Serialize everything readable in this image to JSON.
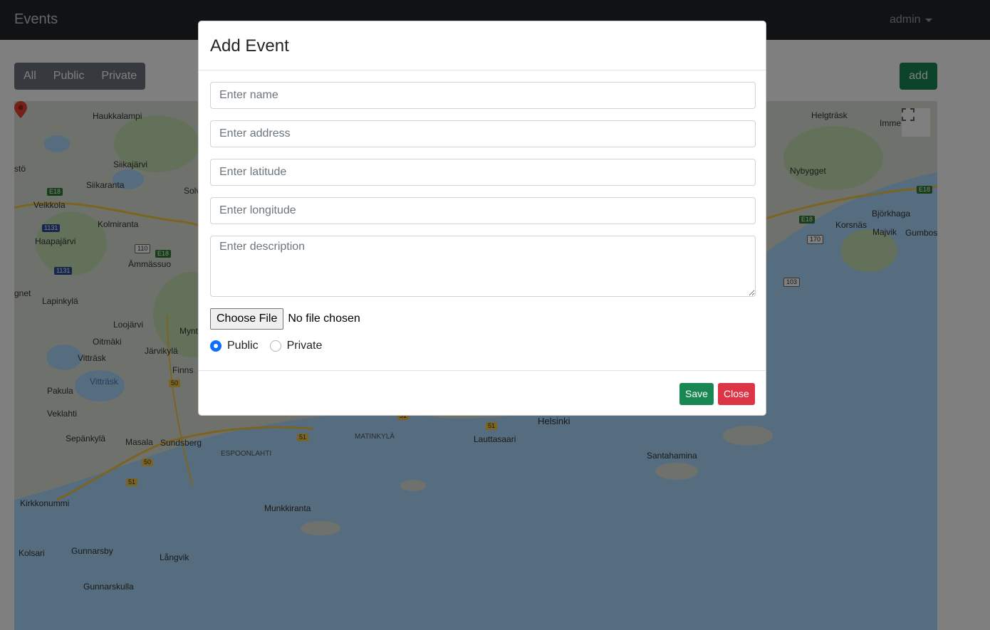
{
  "navbar": {
    "brand": "Events",
    "user": "admin"
  },
  "filters": {
    "all": "All",
    "public": "Public",
    "private": "Private"
  },
  "add_button": "add",
  "map": {
    "labels": [
      "Haukkalampi",
      "Siikajärvi",
      "Siikaranta",
      "Veikkola",
      "Kolmiranta",
      "Haapajärvi",
      "Ämmässuo",
      "Lapinkylä",
      "Loojärvi",
      "Oitmäki",
      "Järvikylä",
      "Vitträsk",
      "Vitträsk",
      "Pakula",
      "Veklahti",
      "Sepänkylä",
      "Masala",
      "Sundsberg",
      "Kirkkonummi",
      "Kolsari",
      "Gunnarsby",
      "Långvik",
      "Gunnarskulla",
      "Munkkiranta",
      "Lauttasaari",
      "Santahamina",
      "Helgträsk",
      "Nybygget",
      "Björkhaga",
      "Korsnäs",
      "Majvik",
      "Gumbos",
      "Finns",
      "MATINKYLÄ",
      "ESPOONLAHTI",
      "Helsinki",
      "stö",
      "gnet",
      "Solv",
      "Mynt",
      "Imme"
    ],
    "shields": [
      "E18",
      "E18",
      "1131",
      "110",
      "1131",
      "50",
      "50",
      "51",
      "51",
      "51",
      "51",
      "E18",
      "E18",
      "170",
      "103"
    ]
  },
  "modal": {
    "title": "Add Event",
    "name_placeholder": "Enter name",
    "address_placeholder": "Enter address",
    "latitude_placeholder": "Enter latitude",
    "longitude_placeholder": "Enter longitude",
    "description_placeholder": "Enter description",
    "file_button": "Choose File",
    "file_status": "No file chosen",
    "radio_public": "Public",
    "radio_private": "Private",
    "save": "Save",
    "close": "Close"
  },
  "colors": {
    "primary": "#0d6efd",
    "success": "#198754",
    "danger": "#dc3545",
    "secondary": "#6c757d",
    "navbar": "#212529"
  }
}
